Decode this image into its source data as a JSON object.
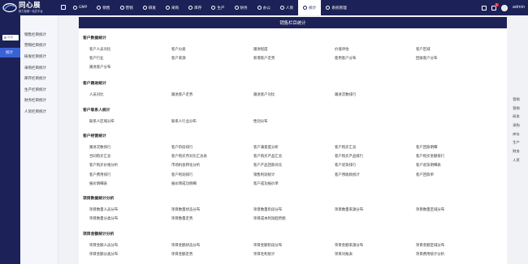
{
  "brand": {
    "title": "同心展",
    "subtitle": "助力营销一站式平台"
  },
  "nav": [
    {
      "label": "GMP",
      "icon": "gmp-icon"
    },
    {
      "label": "销售",
      "icon": "sales-icon"
    },
    {
      "label": "营销",
      "icon": "marketing-icon"
    },
    {
      "label": "研发",
      "icon": "rd-icon"
    },
    {
      "label": "采购",
      "icon": "purchase-icon"
    },
    {
      "label": "库存",
      "icon": "inventory-icon"
    },
    {
      "label": "生产",
      "icon": "production-icon"
    },
    {
      "label": "财务",
      "icon": "finance-icon"
    },
    {
      "label": "办公",
      "icon": "office-icon"
    },
    {
      "label": "人资",
      "icon": "hr-icon"
    },
    {
      "label": "统计",
      "icon": "stats-icon",
      "active": true
    },
    {
      "label": "系统管理",
      "icon": "settings-icon"
    }
  ],
  "header": {
    "badge": "1",
    "user": "admin"
  },
  "sidebar": {
    "search_placeholder": "搜索",
    "active_item": "统计"
  },
  "submenu": [
    "销售栏目统计",
    "营销栏目统计",
    "研发栏目统计",
    "采购栏目统计",
    "库存栏目统计",
    "生产栏目统计",
    "财务栏目统计",
    "人资栏目统计"
  ],
  "panel_title": "销售栏目统计",
  "sections": [
    {
      "title": "客户数据统计",
      "rows": [
        [
          "客户人员对比",
          "客户分类",
          "跟进程度",
          "价值评估",
          "客户区域"
        ],
        [
          "客户行业",
          "客户来源",
          "新增客户走势",
          "使用客户分布",
          "回收客户分布"
        ],
        [
          "跟进客户分布"
        ]
      ]
    },
    {
      "title": "客户跟进统计",
      "rows": [
        [
          "人员对比",
          "跟进客户走势",
          "跟进客户对比",
          "跟进次数排行"
        ]
      ]
    },
    {
      "title": "客户联系人统计",
      "rows": [
        [
          "联系人区域分布",
          "联系人行业分布",
          "性别分布"
        ]
      ]
    },
    {
      "title": "客户经营统计",
      "rows": [
        [
          "跟进次数排行",
          "客户阶段排行",
          "客户满意度分析",
          "客户购买汇总",
          "客户回款明细"
        ],
        [
          "合同购买汇总",
          "客户购买月对比汇总表",
          "客户购买产品汇总",
          "客户购买产品排行",
          "客户购买金额排行"
        ],
        [
          "客户购买价格分析",
          "市场机会转化分析",
          "客户产品回款对比",
          "客户退货排行",
          "客户退货明细表"
        ],
        [
          "客户费用排行",
          "客户利润排行",
          "销售利润统计",
          "客户预收款统计",
          "客户回款单"
        ],
        [
          "报价明细表",
          "报价转成功明细",
          "客户成功报价单"
        ]
      ]
    },
    {
      "title": "项目数据统计分析",
      "rows": [
        [
          "项目数量人员分布",
          "项目数量状态分布",
          "项目数量阶段分布",
          "项目数量来源分布",
          "项目数量区域分布"
        ],
        [
          "项目数量分类分布",
          "项目数量走势",
          "项目成本利润趋势图"
        ]
      ]
    },
    {
      "title": "项目金额统计分析",
      "rows": [
        [
          "项目金额人员分布",
          "项目金额状态分布",
          "项目金额阶段分布",
          "项目金额来源分布",
          "项目金额区域分布"
        ],
        [
          "项目金额分类分布",
          "项目金额走势",
          "项目毛利统计",
          "项目对账表",
          "项目费用统计分析"
        ]
      ]
    }
  ],
  "rail": [
    "营销",
    "营销",
    "研发",
    "采购",
    "库存",
    "生产",
    "财务",
    "人资"
  ]
}
